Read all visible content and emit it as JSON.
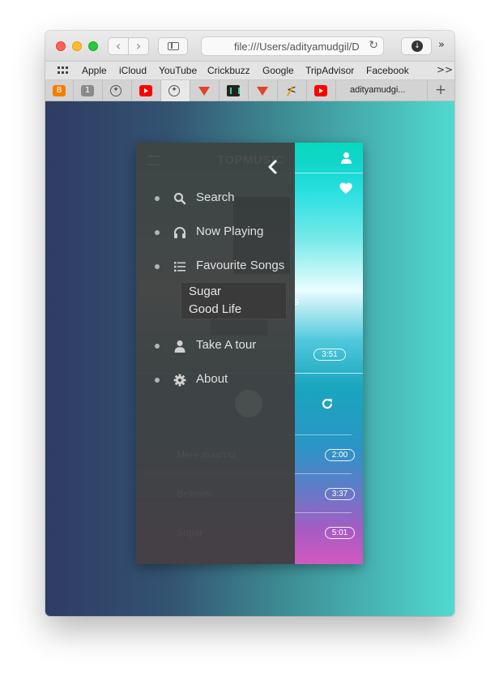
{
  "browser": {
    "url": "file:///Users/adityamudgil/Do",
    "bookmarks": [
      "Apple",
      "iCloud",
      "YouTube",
      "Crickbuzz",
      "Google",
      "TripAdvisor",
      "Facebook"
    ],
    "bookmarks_more": ">>",
    "tab_badge": "1",
    "active_tab_title": "adityamudgi..."
  },
  "app": {
    "ghost_title": "TOPMUSIC",
    "peek_text": "s",
    "now_playing_duration": "3:51",
    "songs": [
      {
        "title": "Mere maan ta",
        "duration": "2:00"
      },
      {
        "title": "Believer",
        "duration": "3:37"
      },
      {
        "title": "Sugar",
        "duration": "5:01"
      }
    ]
  },
  "drawer": {
    "menu": [
      {
        "label": "Search",
        "icon": "search-icon"
      },
      {
        "label": "Now Playing",
        "icon": "headphones-icon"
      },
      {
        "label": "Favourite Songs",
        "icon": "list-icon"
      },
      {
        "label": "Take A tour",
        "icon": "user-icon"
      },
      {
        "label": "About",
        "icon": "gear-icon"
      }
    ],
    "favourites": [
      "Sugar",
      "Good Life"
    ]
  },
  "colors": {
    "drawer_bg": "#404040",
    "accent_teal": "#07d9bd",
    "accent_magenta": "#d05ac0"
  }
}
